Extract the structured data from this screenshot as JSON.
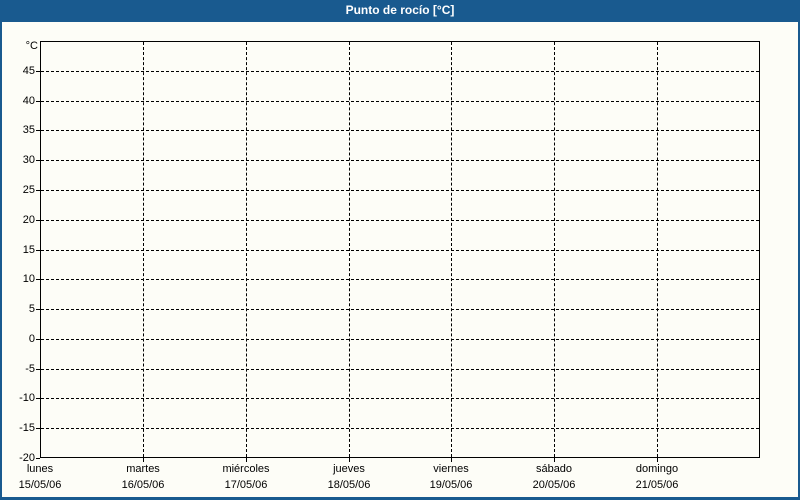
{
  "window": {
    "title": "Punto de rocío [°C]"
  },
  "colors": {
    "frame_and_titlebar": "#195a8f",
    "titlebar_text": "#ffffff",
    "content_background": "#fdfdf7",
    "grid_and_axis": "#000000",
    "label_text": "#000000"
  },
  "chart_data": {
    "type": "line",
    "title": "Punto de rocío [°C]",
    "xlabel": "",
    "ylabel": "°C",
    "ylim": [
      -20,
      50
    ],
    "y_tick_step": 5,
    "y_tick_values": [
      45,
      40,
      35,
      30,
      25,
      20,
      15,
      10,
      5,
      0,
      -5,
      -10,
      -15,
      -20
    ],
    "y_unit_label": "°C",
    "categories": [
      "lunes 15/05/06",
      "martes 16/05/06",
      "miércoles 17/05/06",
      "jueves 18/05/06",
      "viernes 19/05/06",
      "sábado 20/05/06",
      "domingo 21/05/06"
    ],
    "x_axis_days": [
      {
        "name": "lunes",
        "date": "15/05/06"
      },
      {
        "name": "martes",
        "date": "16/05/06"
      },
      {
        "name": "miércoles",
        "date": "17/05/06"
      },
      {
        "name": "jueves",
        "date": "18/05/06"
      },
      {
        "name": "viernes",
        "date": "19/05/06"
      },
      {
        "name": "sábado",
        "date": "20/05/06"
      },
      {
        "name": "domingo",
        "date": "21/05/06"
      }
    ],
    "series": [],
    "grid": {
      "style": "dashed",
      "horizontal": true,
      "vertical": true
    },
    "legend_position": "none"
  }
}
